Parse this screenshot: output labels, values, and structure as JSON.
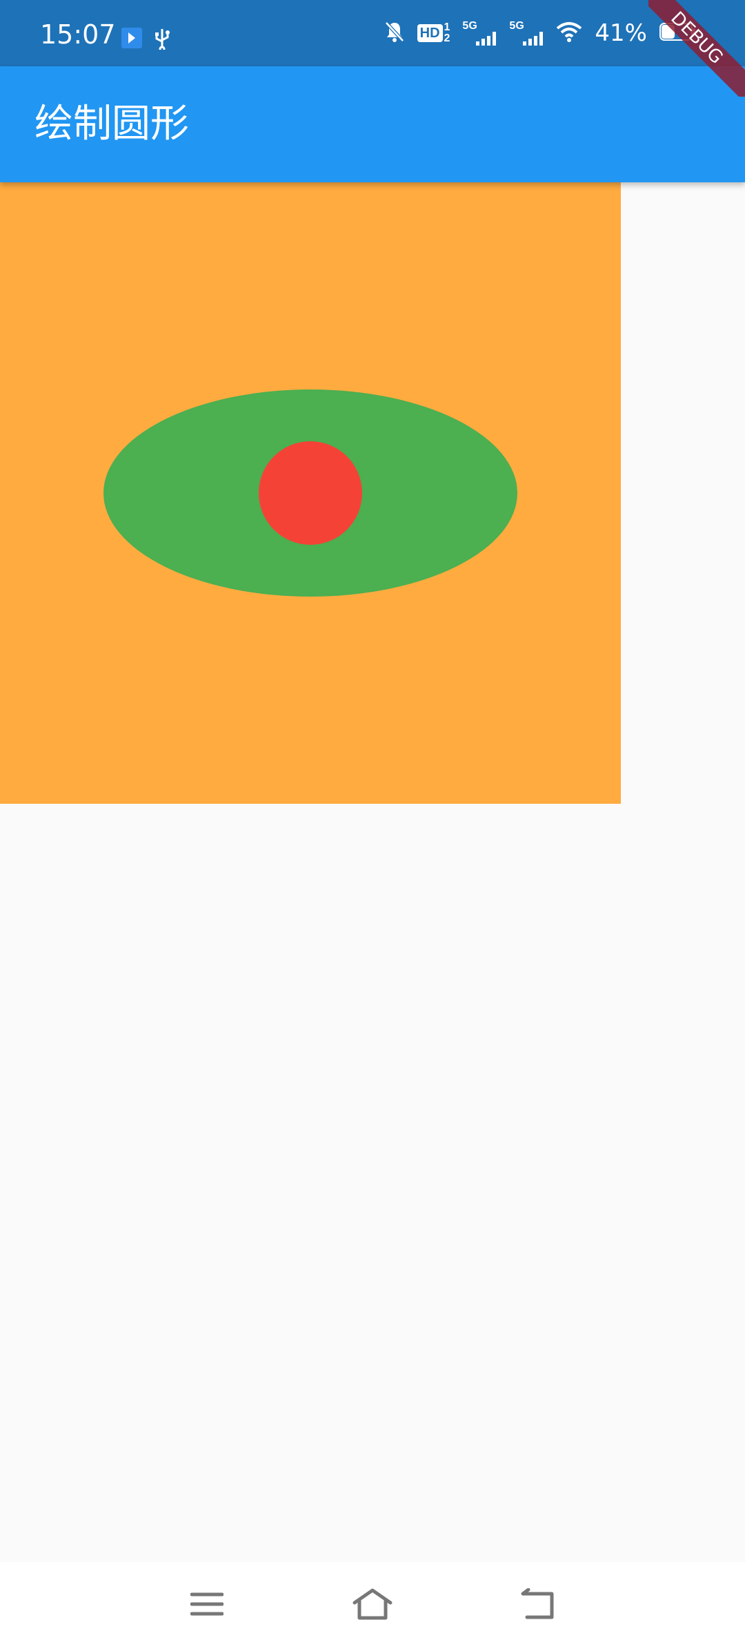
{
  "status_bar": {
    "time": "15:07",
    "battery_percent": "41%",
    "hd_label": "HD",
    "net1": "5G",
    "net2": "5G",
    "left_icons": [
      "cast-icon",
      "usb-icon"
    ],
    "right_icons": [
      "bell-muted-icon",
      "hd-icon",
      "signal-5g-icon",
      "signal-5g-icon",
      "wifi-icon",
      "battery-icon"
    ]
  },
  "app_bar": {
    "title": "绘制圆形"
  },
  "debug_banner": {
    "label": "DEBUG"
  },
  "colors": {
    "status_bar": "#1E72B8",
    "app_bar": "#2196F3",
    "canvas_bg": "#FFAB40",
    "ellipse": "#4CAF50",
    "circle": "#F44336",
    "page_bg": "#FAFAFA"
  },
  "nav_bar": {
    "icons": [
      "menu-icon",
      "home-icon",
      "back-icon"
    ]
  }
}
